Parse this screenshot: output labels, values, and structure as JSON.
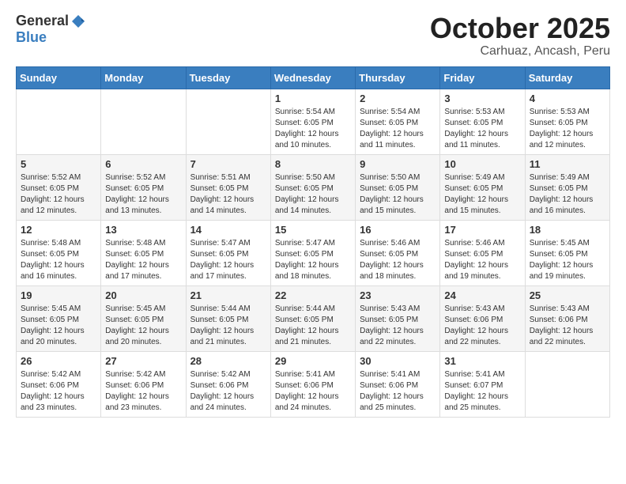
{
  "header": {
    "logo_general": "General",
    "logo_blue": "Blue",
    "month": "October 2025",
    "location": "Carhuaz, Ancash, Peru"
  },
  "weekdays": [
    "Sunday",
    "Monday",
    "Tuesday",
    "Wednesday",
    "Thursday",
    "Friday",
    "Saturday"
  ],
  "weeks": [
    [
      {
        "day": "",
        "info": ""
      },
      {
        "day": "",
        "info": ""
      },
      {
        "day": "",
        "info": ""
      },
      {
        "day": "1",
        "info": "Sunrise: 5:54 AM\nSunset: 6:05 PM\nDaylight: 12 hours\nand 10 minutes."
      },
      {
        "day": "2",
        "info": "Sunrise: 5:54 AM\nSunset: 6:05 PM\nDaylight: 12 hours\nand 11 minutes."
      },
      {
        "day": "3",
        "info": "Sunrise: 5:53 AM\nSunset: 6:05 PM\nDaylight: 12 hours\nand 11 minutes."
      },
      {
        "day": "4",
        "info": "Sunrise: 5:53 AM\nSunset: 6:05 PM\nDaylight: 12 hours\nand 12 minutes."
      }
    ],
    [
      {
        "day": "5",
        "info": "Sunrise: 5:52 AM\nSunset: 6:05 PM\nDaylight: 12 hours\nand 12 minutes."
      },
      {
        "day": "6",
        "info": "Sunrise: 5:52 AM\nSunset: 6:05 PM\nDaylight: 12 hours\nand 13 minutes."
      },
      {
        "day": "7",
        "info": "Sunrise: 5:51 AM\nSunset: 6:05 PM\nDaylight: 12 hours\nand 14 minutes."
      },
      {
        "day": "8",
        "info": "Sunrise: 5:50 AM\nSunset: 6:05 PM\nDaylight: 12 hours\nand 14 minutes."
      },
      {
        "day": "9",
        "info": "Sunrise: 5:50 AM\nSunset: 6:05 PM\nDaylight: 12 hours\nand 15 minutes."
      },
      {
        "day": "10",
        "info": "Sunrise: 5:49 AM\nSunset: 6:05 PM\nDaylight: 12 hours\nand 15 minutes."
      },
      {
        "day": "11",
        "info": "Sunrise: 5:49 AM\nSunset: 6:05 PM\nDaylight: 12 hours\nand 16 minutes."
      }
    ],
    [
      {
        "day": "12",
        "info": "Sunrise: 5:48 AM\nSunset: 6:05 PM\nDaylight: 12 hours\nand 16 minutes."
      },
      {
        "day": "13",
        "info": "Sunrise: 5:48 AM\nSunset: 6:05 PM\nDaylight: 12 hours\nand 17 minutes."
      },
      {
        "day": "14",
        "info": "Sunrise: 5:47 AM\nSunset: 6:05 PM\nDaylight: 12 hours\nand 17 minutes."
      },
      {
        "day": "15",
        "info": "Sunrise: 5:47 AM\nSunset: 6:05 PM\nDaylight: 12 hours\nand 18 minutes."
      },
      {
        "day": "16",
        "info": "Sunrise: 5:46 AM\nSunset: 6:05 PM\nDaylight: 12 hours\nand 18 minutes."
      },
      {
        "day": "17",
        "info": "Sunrise: 5:46 AM\nSunset: 6:05 PM\nDaylight: 12 hours\nand 19 minutes."
      },
      {
        "day": "18",
        "info": "Sunrise: 5:45 AM\nSunset: 6:05 PM\nDaylight: 12 hours\nand 19 minutes."
      }
    ],
    [
      {
        "day": "19",
        "info": "Sunrise: 5:45 AM\nSunset: 6:05 PM\nDaylight: 12 hours\nand 20 minutes."
      },
      {
        "day": "20",
        "info": "Sunrise: 5:45 AM\nSunset: 6:05 PM\nDaylight: 12 hours\nand 20 minutes."
      },
      {
        "day": "21",
        "info": "Sunrise: 5:44 AM\nSunset: 6:05 PM\nDaylight: 12 hours\nand 21 minutes."
      },
      {
        "day": "22",
        "info": "Sunrise: 5:44 AM\nSunset: 6:05 PM\nDaylight: 12 hours\nand 21 minutes."
      },
      {
        "day": "23",
        "info": "Sunrise: 5:43 AM\nSunset: 6:05 PM\nDaylight: 12 hours\nand 22 minutes."
      },
      {
        "day": "24",
        "info": "Sunrise: 5:43 AM\nSunset: 6:06 PM\nDaylight: 12 hours\nand 22 minutes."
      },
      {
        "day": "25",
        "info": "Sunrise: 5:43 AM\nSunset: 6:06 PM\nDaylight: 12 hours\nand 22 minutes."
      }
    ],
    [
      {
        "day": "26",
        "info": "Sunrise: 5:42 AM\nSunset: 6:06 PM\nDaylight: 12 hours\nand 23 minutes."
      },
      {
        "day": "27",
        "info": "Sunrise: 5:42 AM\nSunset: 6:06 PM\nDaylight: 12 hours\nand 23 minutes."
      },
      {
        "day": "28",
        "info": "Sunrise: 5:42 AM\nSunset: 6:06 PM\nDaylight: 12 hours\nand 24 minutes."
      },
      {
        "day": "29",
        "info": "Sunrise: 5:41 AM\nSunset: 6:06 PM\nDaylight: 12 hours\nand 24 minutes."
      },
      {
        "day": "30",
        "info": "Sunrise: 5:41 AM\nSunset: 6:06 PM\nDaylight: 12 hours\nand 25 minutes."
      },
      {
        "day": "31",
        "info": "Sunrise: 5:41 AM\nSunset: 6:07 PM\nDaylight: 12 hours\nand 25 minutes."
      },
      {
        "day": "",
        "info": ""
      }
    ]
  ]
}
